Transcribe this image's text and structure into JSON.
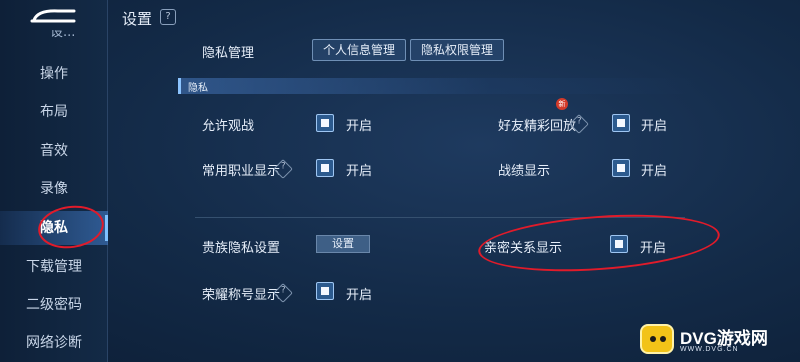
{
  "header": {
    "title": "设置",
    "help": "?"
  },
  "sidebar": {
    "partial_top": "设...",
    "items": [
      {
        "label": "操作"
      },
      {
        "label": "布局"
      },
      {
        "label": "音效"
      },
      {
        "label": "录像"
      },
      {
        "label": "隐私"
      },
      {
        "label": "下载管理"
      },
      {
        "label": "二级密码"
      },
      {
        "label": "网络诊断"
      }
    ],
    "active": "隐私"
  },
  "privacy_management": {
    "label": "隐私管理",
    "personal_info_button": "个人信息管理",
    "permission_button": "隐私权限管理"
  },
  "section": {
    "title": "隐私"
  },
  "settings": {
    "allow_spectate": {
      "label": "允许观战",
      "state": "开启"
    },
    "common_role": {
      "label": "常用职业显示",
      "state": "开启"
    },
    "friend_highlight": {
      "label": "好友精彩回放",
      "state": "开启",
      "badge": "新"
    },
    "record_display": {
      "label": "战绩显示",
      "state": "开启"
    },
    "noble_privacy": {
      "label": "贵族隐私设置",
      "button": "设置"
    },
    "intimate_display": {
      "label": "亲密关系显示",
      "state": "开启"
    },
    "honor_title": {
      "label": "荣耀称号显示",
      "state": "开启"
    }
  },
  "watermark": {
    "brand": "DVG游戏网",
    "url": "WWW.DVG.CN"
  },
  "colors": {
    "accent": "#7ec1ff",
    "highlight_circle": "#e11b2a",
    "checkbox": "#2c5a8e"
  }
}
